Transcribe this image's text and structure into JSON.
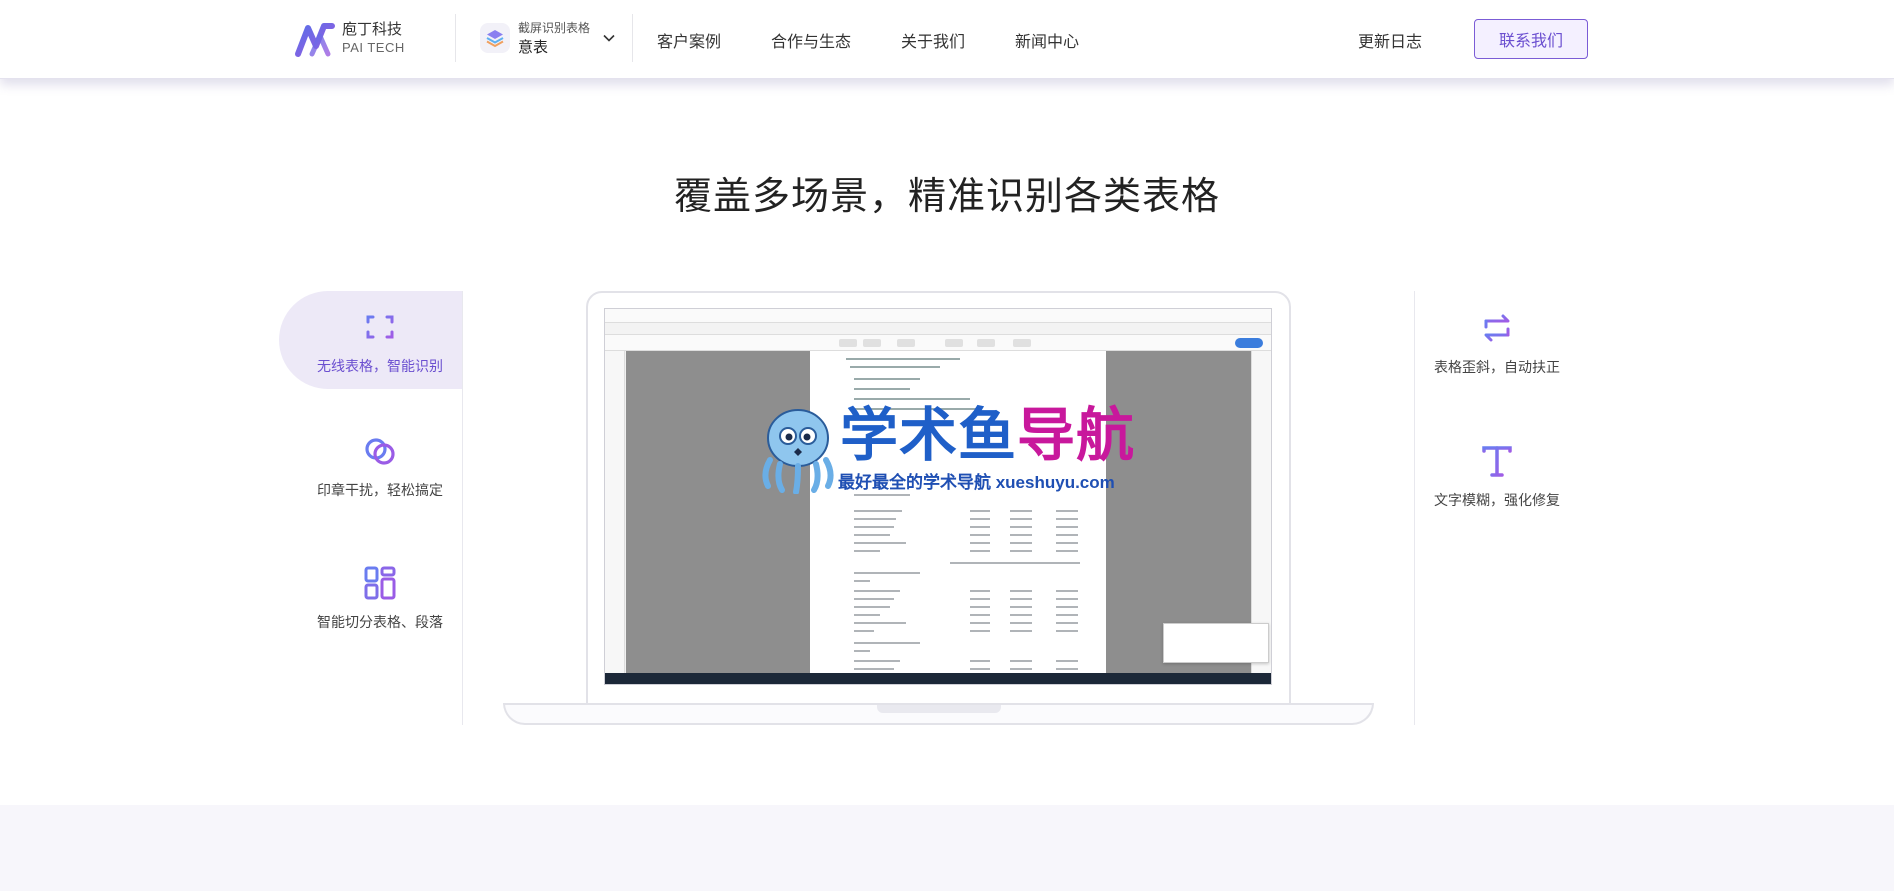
{
  "header": {
    "logo": {
      "name": "庖丁科技",
      "sub": "PAI TECH"
    },
    "product": {
      "subtitle": "截屏识别表格",
      "name": "意表"
    },
    "nav": [
      "客户案例",
      "合作与生态",
      "关于我们",
      "新闻中心"
    ],
    "changelog": "更新日志",
    "contact": "联系我们"
  },
  "main": {
    "headline": "覆盖多场景，精准识别各类表格",
    "left_features": [
      {
        "label": "无线表格，智能识别",
        "icon": "scan-table-icon",
        "active": true
      },
      {
        "label": "印章干扰，轻松搞定",
        "icon": "stamp-rings-icon",
        "active": false
      },
      {
        "label": "智能切分表格、段落",
        "icon": "layout-split-icon",
        "active": false
      }
    ],
    "right_features": [
      {
        "label": "表格歪斜，自动扶正",
        "icon": "rotate-correct-icon"
      },
      {
        "label": "文字模糊，强化修复",
        "icon": "text-t-icon"
      }
    ]
  },
  "watermark": {
    "title_part1": "学术鱼",
    "title_part2": "导航",
    "subtitle": "最好最全的学术导航 xueshuyu.com"
  },
  "colors": {
    "accent": "#6b4fd0",
    "active_bg": "#ede9f7",
    "watermark_blue": "#1f5fc8",
    "watermark_magenta": "#c8189c"
  }
}
